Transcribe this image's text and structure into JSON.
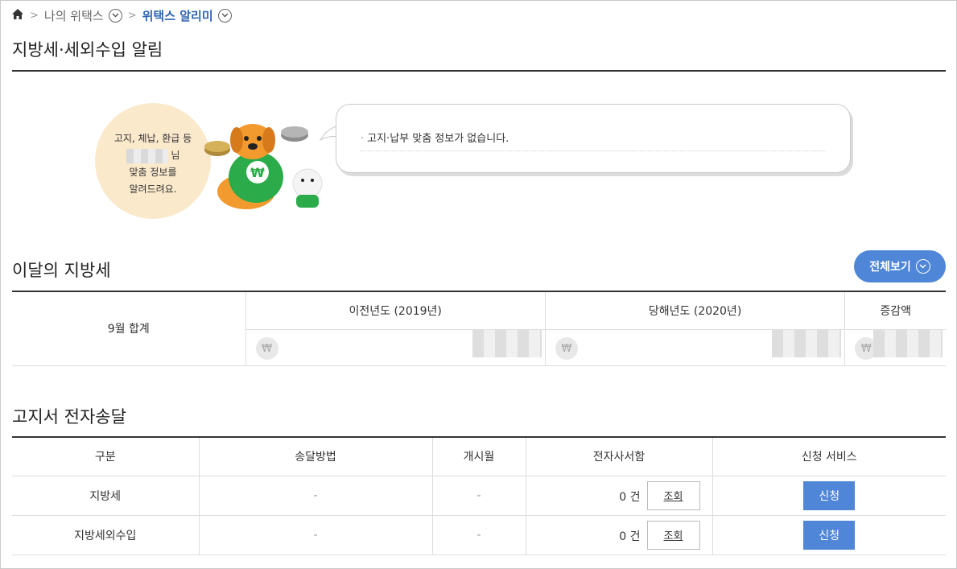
{
  "breadcrumb": {
    "item1": "나의 위택스",
    "item2": "위택스 알리미"
  },
  "page_title": "지방세·세외수입 알림",
  "notice": {
    "circle_line1": "고지, 체납, 환급 등",
    "circle_line2_suffix": "님",
    "circle_line3": "맞춤 정보를",
    "circle_line4": "알려드려요.",
    "speech_text": "고지·납부 맞춤 정보가 없습니다."
  },
  "monthly": {
    "title": "이달의 지방세",
    "view_all": "전체보기",
    "row_label": "9월 합계",
    "headers": [
      "이전년도 (2019년)",
      "당해년도 (2020년)",
      "증감액"
    ],
    "currency_symbol": "₩"
  },
  "delivery": {
    "title": "고지서 전자송달",
    "headers": [
      "구분",
      "송달방법",
      "개시월",
      "전자사서함",
      "신청 서비스"
    ],
    "rows": [
      {
        "category": "지방세",
        "method": "-",
        "start": "-",
        "count": "0 건",
        "view": "조회",
        "apply": "신청"
      },
      {
        "category": "지방세외수입",
        "method": "-",
        "start": "-",
        "count": "0 건",
        "view": "조회",
        "apply": "신청"
      }
    ]
  },
  "colors": {
    "accent": "#4f86d8",
    "breadcrumb_current": "#2f66b3",
    "bubble": "#fbe9cc"
  }
}
